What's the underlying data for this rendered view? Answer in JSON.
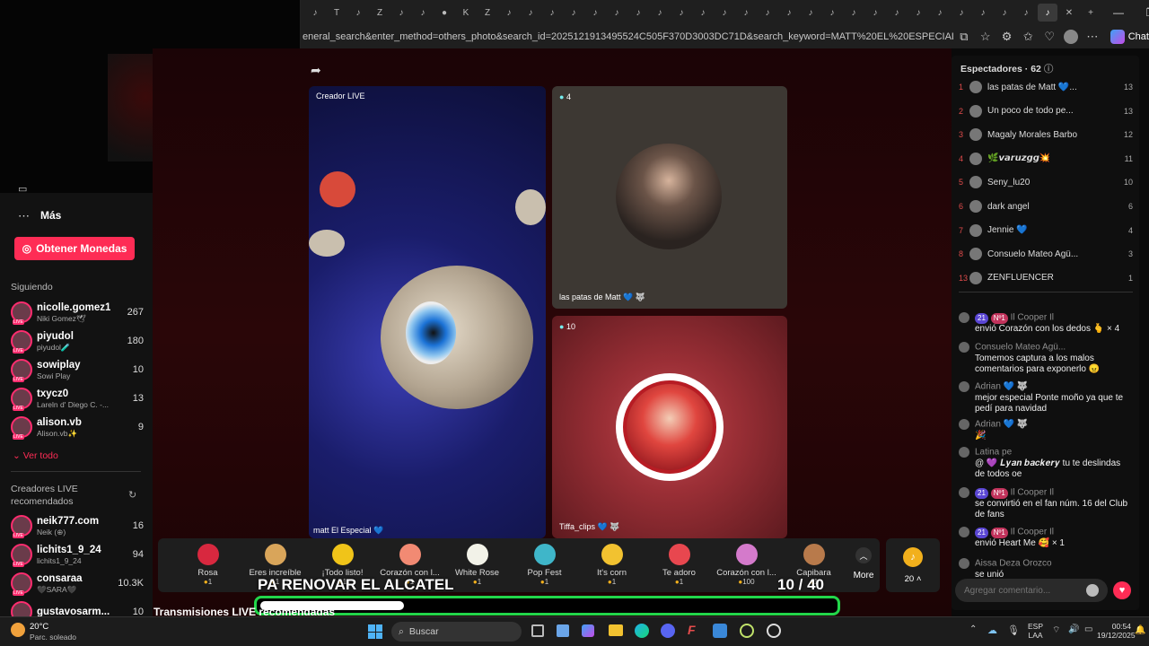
{
  "browser": {
    "url": "eneral_search&enter_method=others_photo&search_id=20251219134955​24C505F370D3003DC71D&search_keyword=MATT%20EL%20ESPECIAL&search_result_id=734439171...",
    "chat_label": "Chat",
    "tab_glyphs": [
      "K",
      "S",
      "✉",
      "N",
      "●",
      "✉",
      "I",
      "K",
      "K",
      "A",
      "▶",
      "L",
      "♪",
      "♪",
      "T",
      "♪",
      "Z",
      "♪",
      "♪",
      "●",
      "K",
      "Z",
      "♪",
      "♪",
      "♪",
      "♪",
      "♪",
      "♪",
      "♪",
      "♪",
      "♪",
      "♪",
      "♪",
      "♪",
      "♪",
      "♪",
      "♪",
      "♪",
      "♪",
      "♪",
      "♪",
      "♪",
      "♪",
      "♪",
      "♪",
      "♪",
      "♪"
    ]
  },
  "sidebar": {
    "more_label": "Más",
    "coins_button": "Obtener Monedas",
    "following_title": "Siguiendo",
    "following": [
      {
        "name": "nicolle.gomez1",
        "sub": "Niki Gomez🕊",
        "count": "267"
      },
      {
        "name": "piyudol",
        "sub": "piyudol🧪",
        "count": "180"
      },
      {
        "name": "sowiplay",
        "sub": "Sowi Play",
        "count": "10"
      },
      {
        "name": "txycz0",
        "sub": "Lareln d' Diego C. -...",
        "count": "13"
      },
      {
        "name": "alison.vb",
        "sub": "Alison.vb✨",
        "count": "9"
      }
    ],
    "see_all": "Ver todo",
    "recommended_title": "Creadores LIVE recomendados",
    "recommended": [
      {
        "name": "neik777.com",
        "sub": "Neik (⊕)",
        "count": "16"
      },
      {
        "name": "lichits1_9_24",
        "sub": "lichits1_9_24",
        "count": "94"
      },
      {
        "name": "consaraa",
        "sub": "🖤SARA🖤",
        "count": "10.3K"
      },
      {
        "name": "gustavosarm...",
        "sub": "",
        "count": "10"
      }
    ]
  },
  "stream": {
    "host_label": "Creador LIVE",
    "host_name": "matt El Especial 💙",
    "guest1_viewers": "4",
    "guest1_name": "las patas de Matt 💙 🐺",
    "guest2_viewers": "10",
    "guest2_name": "Tiffa_clips 💙 🐺",
    "recommended_heading": "Transmisiones LIVE recomendadas",
    "overlay_text": "PA RENOVAR EL ALCATEL",
    "progress_text": "10 / 40",
    "progress_fraction": 0.25
  },
  "gifts": [
    {
      "name": "Rosa",
      "price": "1",
      "color": "#d8283f"
    },
    {
      "name": "Eres increíble",
      "price": "1",
      "color": "#d9a55a"
    },
    {
      "name": "¡Todo listo!",
      "price": "1",
      "color": "#f0c419"
    },
    {
      "name": "Corazón con l...",
      "price": "1",
      "color": "#f28a73"
    },
    {
      "name": "White Rose",
      "price": "1",
      "color": "#f2f2e8"
    },
    {
      "name": "Pop Fest",
      "price": "1",
      "color": "#3fb6c9"
    },
    {
      "name": "It's corn",
      "price": "1",
      "color": "#f2c230"
    },
    {
      "name": "Te adoro",
      "price": "1",
      "color": "#e8474f"
    },
    {
      "name": "Corazón con l...",
      "price": "100",
      "color": "#d47acb"
    },
    {
      "name": "Capibara",
      "price": "1",
      "color": "#b87a4b"
    }
  ],
  "gift_more": "More",
  "coins_balance": "20",
  "viewers_panel": {
    "title": "Espectadores · 62",
    "ranking": [
      {
        "rank": "1",
        "name": "las patas de Matt 💙...",
        "score": "13"
      },
      {
        "rank": "2",
        "name": "Un poco de todo pe...",
        "score": "13"
      },
      {
        "rank": "3",
        "name": "Magaly Morales Barbo",
        "score": "12"
      },
      {
        "rank": "4",
        "name": "🌿𝙫𝙖𝙧𝙪𝙯𝙜𝙜💥",
        "score": "11"
      },
      {
        "rank": "5",
        "name": "Seny_lu20",
        "score": "10"
      },
      {
        "rank": "6",
        "name": "dark angel",
        "score": "6"
      },
      {
        "rank": "7",
        "name": "Jennie 💙",
        "score": "4"
      },
      {
        "rank": "8",
        "name": "Consuelo Mateo Agü...",
        "score": "3"
      },
      {
        "rank": "13",
        "name": "ZENFLUENCER",
        "score": "1"
      }
    ]
  },
  "chat": {
    "messages": [
      {
        "name": "Il Cooper Il",
        "badge": "21",
        "badge2": "Nº1",
        "text": "envió Corazón con los dedos 🫰 × 4"
      },
      {
        "name": "Consuelo Mateo Agü...",
        "text": "Tomemos captura a los malos comentarios para exponerlo 😠"
      },
      {
        "name": "Adrian 💙 🐺",
        "text": "mejor especial Ponte moño ya que te pedí para navidad"
      },
      {
        "name": "Adrian 💙 🐺",
        "text": "🎉"
      },
      {
        "name": "Latina pe",
        "text": "@ 💜 𝑳𝒚𝒂𝒏 𝒃𝒂𝒄𝒌𝒆𝒓𝒚 tu te deslindas de todos oe"
      },
      {
        "name": "Il Cooper Il",
        "badge": "21",
        "badge2": "Nº1",
        "text": "se convirtió en el fan núm. 16 del Club de fans"
      },
      {
        "name": "Il Cooper Il",
        "badge": "21",
        "badge2": "Nº1",
        "text": "envió Heart Me 🥰 × 1"
      },
      {
        "name": "Aissa Deza Orozco",
        "text": "se unió"
      }
    ],
    "input_placeholder": "Agregar comentario..."
  },
  "taskbar": {
    "weather_temp": "20°C",
    "weather_desc": "Parc. soleado",
    "search_label": "Buscar",
    "lang": "ESP",
    "lang2": "LAA",
    "time": "00:54",
    "date": "19/12/2025"
  }
}
